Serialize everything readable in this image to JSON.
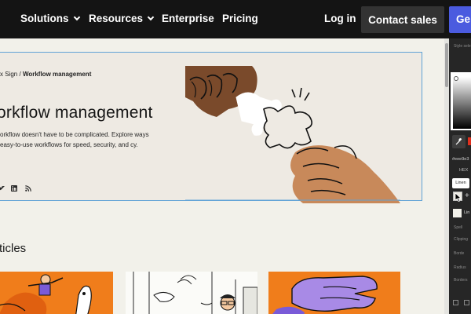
{
  "nav": {
    "items": [
      {
        "label": "Solutions",
        "chevron": true
      },
      {
        "label": "Resources",
        "chevron": true
      },
      {
        "label": "Enterprise",
        "chevron": false
      },
      {
        "label": "Pricing",
        "chevron": false
      }
    ],
    "login": "Log in",
    "contact_sales": "Contact sales",
    "get_started": "Ge"
  },
  "hero": {
    "breadcrumb_parent": "x Sign",
    "breadcrumb_sep": "/",
    "breadcrumb_current": "Workflow management",
    "title": "orkflow management",
    "description": "orkflow doesn't have to be complicated. Explore ways easy-to-use workflows for speed, security, and cy.",
    "social_icons": [
      "twitter-icon",
      "linkedin-icon",
      "rss-icon"
    ]
  },
  "articles": {
    "title": "rticles"
  },
  "editor_panel": {
    "hex_value": "#eee9e3",
    "hex_label": "HEX",
    "tooltip": "Linen",
    "swatch_label": "Lin",
    "section_labels": [
      "Style sele",
      "Spell",
      "Clipping",
      "Borde",
      "Radius",
      "Borders"
    ]
  },
  "colors": {
    "nav_bg": "#141414",
    "page_bg": "#f2f1ea",
    "hero_bg": "#eeeae3",
    "accent_blue": "#4b5bdf",
    "orange": "#f07d1b",
    "skin": "#c8895a",
    "selection_outline": "#5fa2d6"
  }
}
